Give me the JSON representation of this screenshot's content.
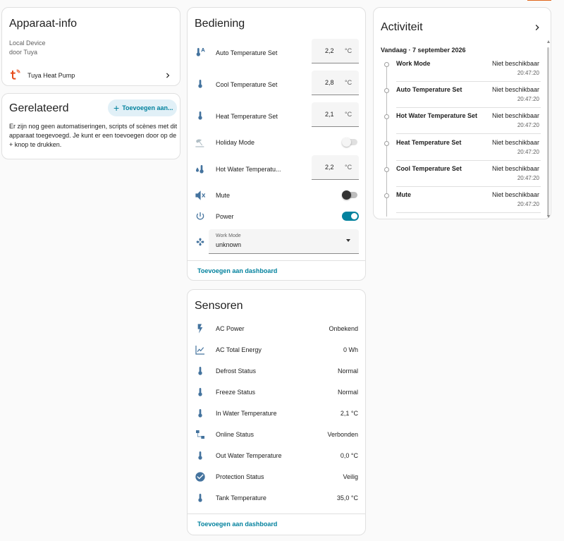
{
  "device_info": {
    "title": "Apparaat-info",
    "model": "Local Device",
    "manufacturer": "door Tuya",
    "integration_label": "Tuya Heat Pump"
  },
  "related": {
    "title": "Gerelateerd",
    "add_button": "Toevoegen aan...",
    "description": "Er zijn nog geen automatiseringen, scripts of scènes met dit apparaat toegevoegd. Je kunt er een toevoegen door op de + knop te drukken."
  },
  "controls": {
    "title": "Bediening",
    "rows": [
      {
        "icon": "thermometer-auto-icon",
        "label": "Auto Temperature Set",
        "value": "2,2",
        "unit": "°C"
      },
      {
        "icon": "thermometer-icon",
        "label": "Cool Temperature Set",
        "value": "2,8",
        "unit": "°C"
      },
      {
        "icon": "thermometer-icon",
        "label": "Heat Temperature Set",
        "value": "2,1",
        "unit": "°C"
      },
      {
        "icon": "beach-icon",
        "label": "Holiday Mode",
        "toggle": "off-disabled"
      },
      {
        "icon": "water-thermometer-icon",
        "label": "Hot Water Temperatu...",
        "value": "2,2",
        "unit": "°C"
      },
      {
        "icon": "volume-off-icon",
        "label": "Mute",
        "toggle": "off"
      },
      {
        "icon": "power-icon",
        "label": "Power",
        "toggle": "on"
      }
    ],
    "work_mode": {
      "icon": "hvac-icon",
      "label": "Work Mode",
      "value": "unknown"
    },
    "add_link": "Toevoegen aan dashboard"
  },
  "sensors": {
    "title": "Sensoren",
    "rows": [
      {
        "icon": "flash-icon",
        "label": "AC Power",
        "value": "Onbekend"
      },
      {
        "icon": "chart-line-icon",
        "label": "AC Total Energy",
        "value": "0 Wh"
      },
      {
        "icon": "thermometer-icon",
        "label": "Defrost Status",
        "value": "Normal"
      },
      {
        "icon": "thermometer-icon",
        "label": "Freeze Status",
        "value": "Normal"
      },
      {
        "icon": "thermometer-icon",
        "label": "In Water Temperature",
        "value": "2,1 °C"
      },
      {
        "icon": "lan-connect-icon",
        "label": "Online Status",
        "value": "Verbonden"
      },
      {
        "icon": "thermometer-icon",
        "label": "Out Water Temperature",
        "value": "0,0 °C"
      },
      {
        "icon": "check-circle-icon",
        "label": "Protection Status",
        "value": "Veilig"
      },
      {
        "icon": "thermometer-icon",
        "label": "Tank Temperature",
        "value": "35,0 °C"
      }
    ],
    "add_link": "Toevoegen aan dashboard"
  },
  "activity": {
    "title": "Activiteit",
    "date": "Vandaag · 7 september 2026",
    "entries": [
      {
        "name": "Work Mode",
        "status": "Niet beschikbaar",
        "time": "20:47:20"
      },
      {
        "name": "Auto Temperature Set",
        "status": "Niet beschikbaar",
        "time": "20:47:20"
      },
      {
        "name": "Hot Water Temperature Set",
        "status": "Niet beschikbaar",
        "time": "20:47:20"
      },
      {
        "name": "Heat Temperature Set",
        "status": "Niet beschikbaar",
        "time": "20:47:20"
      },
      {
        "name": "Cool Temperature Set",
        "status": "Niet beschikbaar",
        "time": "20:47:20"
      },
      {
        "name": "Mute",
        "status": "Niet beschikbaar",
        "time": "20:47:20"
      }
    ]
  },
  "colors": {
    "icon": "#44739e",
    "accent": "#03829e",
    "tuya": "#e64a19"
  }
}
